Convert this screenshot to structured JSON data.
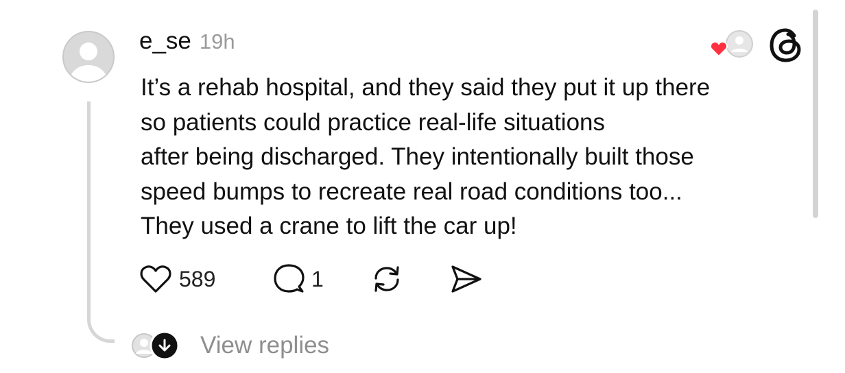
{
  "post": {
    "username": "e_se",
    "time": "19h",
    "text_lines": [
      "It’s a rehab hospital, and they said they put it up there",
      "so patients could practice real-life situations",
      "after being discharged. They intentionally built those",
      "speed bumps to recreate real road conditions too...",
      "They used a crane to lift the car up!"
    ],
    "likes": "589",
    "replies": "1",
    "view_replies_label": "View replies"
  },
  "icons": {
    "avatar": "default-avatar-icon",
    "liked_by": "heart-badge-avatar-icon",
    "logo": "threads-logo-icon",
    "like": "heart-icon",
    "reply": "comment-bubble-icon",
    "repost": "repost-icon",
    "share": "send-icon",
    "view_replies_arrow": "arrow-down-icon"
  },
  "colors": {
    "heart_accent": "#ff3040",
    "muted_text": "#8e8e8e",
    "thread_line": "#d6d6d6"
  }
}
